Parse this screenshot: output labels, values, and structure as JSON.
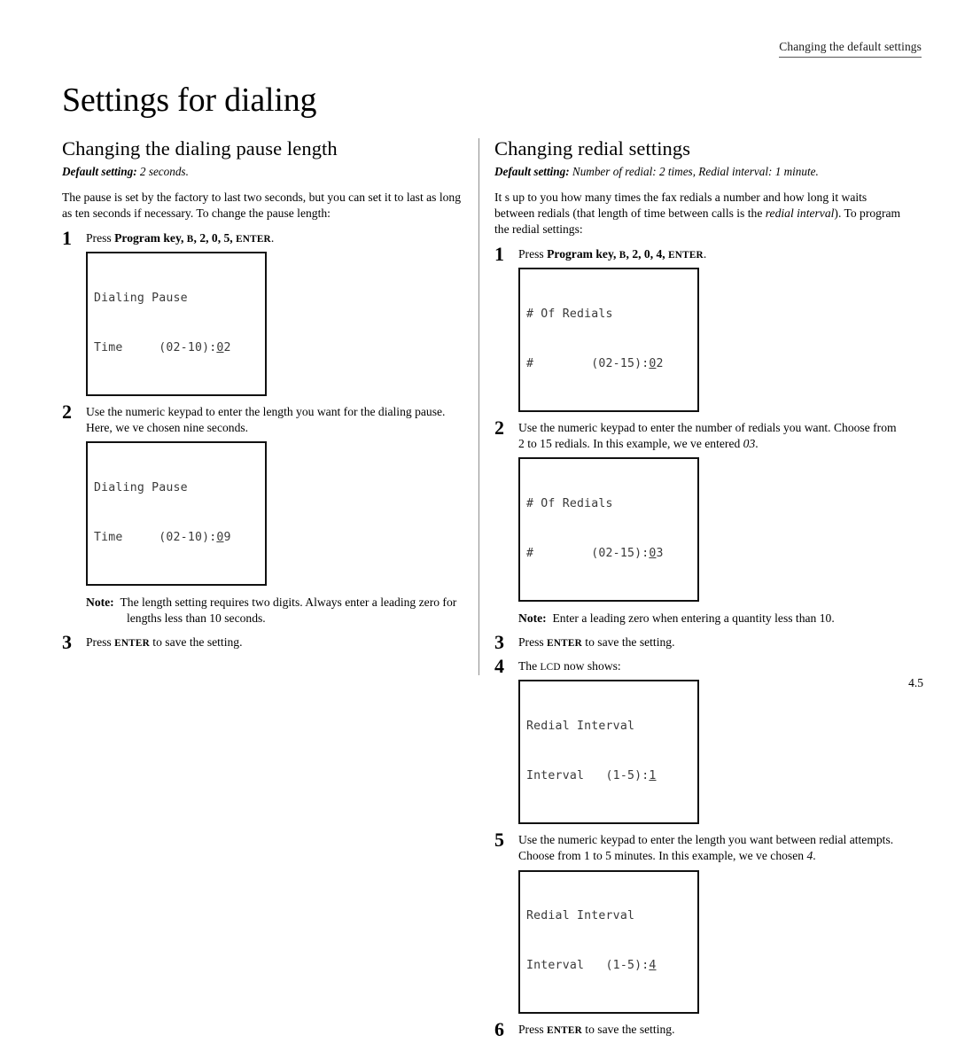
{
  "header": {
    "running_head": "Changing the default settings",
    "page_title": "Settings for dialing",
    "folio": "4.5"
  },
  "left_column": {
    "section_title": "Changing the dialing pause length",
    "default_setting_label": "Default setting:",
    "default_setting_value": " 2 seconds.",
    "intro": "The pause is set by the factory to last two seconds, but you can set it to last as long as ten seconds if necessary. To change the pause length:",
    "steps": [
      {
        "num": "1",
        "text_pre": "Press ",
        "text_bold": "Program key, ",
        "keys_caps": "B",
        "keys_mid": ", 2, 0, 5, ",
        "keys_enter": "ENTER",
        "text_post": ".",
        "lcd": {
          "line1": "Dialing Pause",
          "line2_pre": "Time     (02-10):",
          "line2_cursor": "0",
          "line2_post": "2"
        }
      },
      {
        "num": "2",
        "text": "Use the numeric keypad to enter the length you want for the dialing pause. Here, we ve chosen nine seconds.",
        "lcd": {
          "line1": "Dialing Pause",
          "line2_pre": "Time     (02-10):",
          "line2_cursor": "0",
          "line2_post": "9"
        }
      }
    ],
    "note": {
      "label": "Note:",
      "body": "The length setting requires two digits. Always enter a leading zero for lengths less than 10 seconds."
    },
    "final_step": {
      "num": "3",
      "text_pre": "Press ",
      "keys_enter": "ENTER",
      "text_post": " to save the setting."
    }
  },
  "right_column": {
    "section_title": "Changing redial settings",
    "default_setting_label": "Default setting:",
    "default_setting_value": " Number of redial: 2 times, Redial interval: 1 minute.",
    "intro_pre": "It s up to you how many times the fax redials a number and how long it waits between redials (that length of time between calls is the ",
    "intro_italic": "redial interval",
    "intro_post": "). To program the redial settings:",
    "steps": [
      {
        "num": "1",
        "text_pre": "Press ",
        "text_bold": "Program key, ",
        "keys_caps": "B",
        "keys_mid": ", 2, 0, 4, ",
        "keys_enter": "ENTER",
        "text_post": ".",
        "lcd": {
          "line1": "# Of Redials",
          "line2_pre": "#        (02-15):",
          "line2_cursor": "0",
          "line2_post": "2"
        }
      },
      {
        "num": "2",
        "text_pre": "Use the numeric keypad to enter the number of redials you want. Choose from 2 to 15 redials. In this example, we ve entered ",
        "text_italic": "03",
        "text_post": ".",
        "lcd": {
          "line1": "# Of Redials",
          "line2_pre": "#        (02-15):",
          "line2_cursor": "0",
          "line2_post": "3"
        }
      }
    ],
    "note": {
      "label": "Note:",
      "body": "Enter a leading zero when entering a quantity less than 10."
    },
    "step3": {
      "num": "3",
      "text_pre": "Press ",
      "keys_enter": "ENTER",
      "text_post": " to save the setting."
    },
    "step4": {
      "num": "4",
      "text_pre": "The ",
      "caps": "LCD",
      "text_post": " now shows:",
      "lcd": {
        "line1": "Redial Interval",
        "line2_pre": "Interval   (1-5):",
        "line2_cursor": "1",
        "line2_post": ""
      }
    },
    "step5": {
      "num": "5",
      "text_pre": "Use the numeric keypad to enter the length you want between redial attempts. Choose from 1 to 5 minutes. In this example, we ve chosen ",
      "text_italic": "4",
      "text_post": ".",
      "lcd": {
        "line1": "Redial Interval",
        "line2_pre": "Interval   (1-5):",
        "line2_cursor": "4",
        "line2_post": ""
      }
    },
    "step6": {
      "num": "6",
      "text_pre": "Press ",
      "keys_enter": "ENTER",
      "text_post": " to save the setting."
    }
  }
}
